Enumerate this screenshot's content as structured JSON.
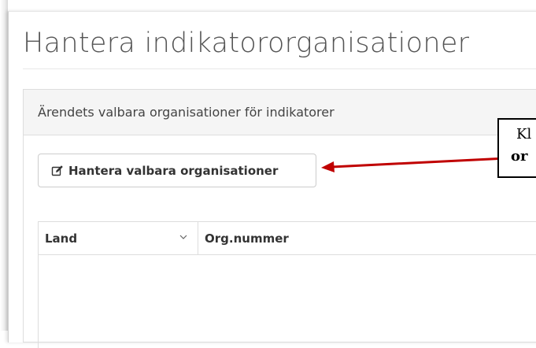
{
  "page": {
    "title": "Hantera indikatororganisationer"
  },
  "panel": {
    "heading": "Ärendets valbara organisationer för indikatorer",
    "manage_button": {
      "label": "Hantera valbara organisationer",
      "icon": "edit-icon"
    }
  },
  "grid": {
    "columns": [
      {
        "label": "Land",
        "has_dropdown": true
      },
      {
        "label": "Org.nummer"
      }
    ],
    "rows": []
  },
  "callout": {
    "line1": "Kl",
    "line2": "or"
  },
  "colors": {
    "arrow": "#c00000",
    "panel_heading_bg": "#f5f5f5"
  }
}
